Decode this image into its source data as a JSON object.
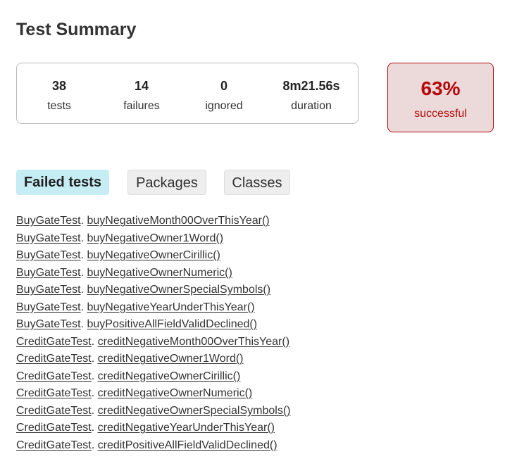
{
  "page": {
    "title": "Test Summary"
  },
  "summary": {
    "tests": {
      "value": "38",
      "label": "tests"
    },
    "failures": {
      "value": "14",
      "label": "failures"
    },
    "ignored": {
      "value": "0",
      "label": "ignored"
    },
    "duration": {
      "value": "8m21.56s",
      "label": "duration"
    }
  },
  "success": {
    "percent": "63%",
    "label": "successful",
    "color": "#b60808",
    "background": "#ecdada"
  },
  "tabs": [
    {
      "label": "Failed tests",
      "active": true
    },
    {
      "label": "Packages",
      "active": false
    },
    {
      "label": "Classes",
      "active": false
    }
  ],
  "failed_tests": [
    {
      "class": "BuyGateTest",
      "method": "buyNegativeMonth00OverThisYear()"
    },
    {
      "class": "BuyGateTest",
      "method": "buyNegativeOwner1Word()"
    },
    {
      "class": "BuyGateTest",
      "method": "buyNegativeOwnerCirillic()"
    },
    {
      "class": "BuyGateTest",
      "method": "buyNegativeOwnerNumeric()"
    },
    {
      "class": "BuyGateTest",
      "method": "buyNegativeOwnerSpecialSymbols()"
    },
    {
      "class": "BuyGateTest",
      "method": "buyNegativeYearUnderThisYear()"
    },
    {
      "class": "BuyGateTest",
      "method": "buyPositiveAllFieldValidDeclined()"
    },
    {
      "class": "CreditGateTest",
      "method": "creditNegativeMonth00OverThisYear()"
    },
    {
      "class": "CreditGateTest",
      "method": "creditNegativeOwner1Word()"
    },
    {
      "class": "CreditGateTest",
      "method": "creditNegativeOwnerCirillic()"
    },
    {
      "class": "CreditGateTest",
      "method": "creditNegativeOwnerNumeric()"
    },
    {
      "class": "CreditGateTest",
      "method": "creditNegativeOwnerSpecialSymbols()"
    },
    {
      "class": "CreditGateTest",
      "method": "creditNegativeYearUnderThisYear()"
    },
    {
      "class": "CreditGateTest",
      "method": "creditPositiveAllFieldValidDeclined()"
    }
  ]
}
